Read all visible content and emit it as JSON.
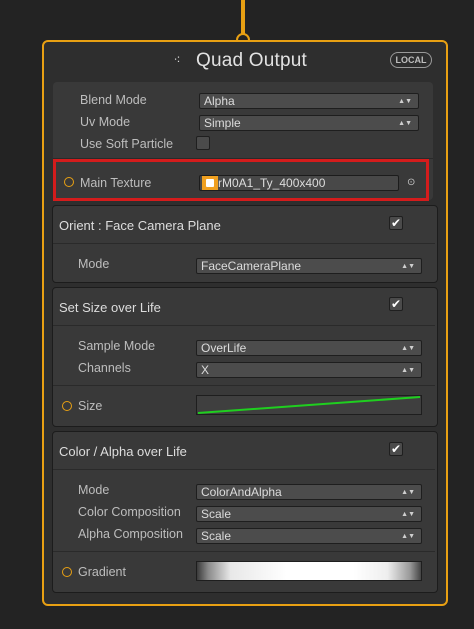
{
  "node": {
    "title": "Quad Output",
    "badge": "LOCAL",
    "accent_color": "#e8a013",
    "icon": "output-icon"
  },
  "main_settings": {
    "blend_mode": {
      "label": "Blend Mode",
      "value": "Alpha"
    },
    "uv_mode": {
      "label": "Uv Mode",
      "value": "Simple"
    },
    "use_soft_particle": {
      "label": "Use Soft Particle",
      "checked": false
    }
  },
  "main_texture": {
    "label": "Main Texture",
    "value": "rM0A1_Ty_400x400",
    "highlight_color": "#d41c1c"
  },
  "blocks": {
    "orient": {
      "title": "Orient : Face Camera Plane",
      "enabled": true,
      "mode": {
        "label": "Mode",
        "value": "FaceCameraPlane"
      }
    },
    "size": {
      "title": "Set Size over Life",
      "enabled": true,
      "sample_mode": {
        "label": "Sample Mode",
        "value": "OverLife"
      },
      "channels": {
        "label": "Channels",
        "value": "X"
      },
      "size": {
        "label": "Size",
        "curve_color": "#1fcf1f"
      }
    },
    "color": {
      "title": "Color / Alpha over Life",
      "enabled": true,
      "mode": {
        "label": "Mode",
        "value": "ColorAndAlpha"
      },
      "color_composition": {
        "label": "Color Composition",
        "value": "Scale"
      },
      "alpha_composition": {
        "label": "Alpha Composition",
        "value": "Scale"
      },
      "gradient": {
        "label": "Gradient"
      }
    }
  },
  "glyphs": {
    "dropdown_arrow": "▲▼",
    "check": "✔",
    "picker": "⊙",
    "output": "⁖"
  }
}
